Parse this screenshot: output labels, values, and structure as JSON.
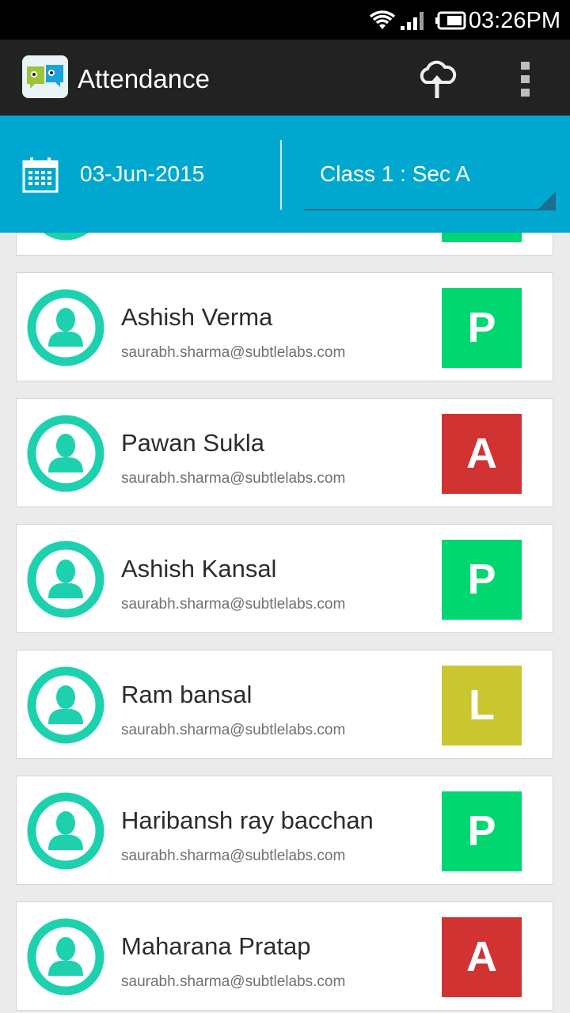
{
  "status_bar": {
    "time": "03:26PM"
  },
  "app_bar": {
    "title": "Attendance",
    "logo": "app-logo-icon",
    "upload_icon": "cloud-upload-icon",
    "menu_icon": "overflow-menu-icon"
  },
  "filter": {
    "date": "03-Jun-2015",
    "class_section": "Class 1 : Sec A",
    "calendar_icon": "calendar-icon"
  },
  "colors": {
    "present": "#00d770",
    "absent": "#d13333",
    "leave": "#c9c72f",
    "header": "#00a8cf",
    "appbar": "#222222",
    "avatar": "#1ed1ae"
  },
  "students": [
    {
      "name": "",
      "email": "",
      "status": "P"
    },
    {
      "name": "Ashish Verma",
      "email": "saurabh.sharma@subtlelabs.com",
      "status": "P"
    },
    {
      "name": "Pawan Sukla",
      "email": "saurabh.sharma@subtlelabs.com",
      "status": "A"
    },
    {
      "name": "Ashish Kansal",
      "email": "saurabh.sharma@subtlelabs.com",
      "status": "P"
    },
    {
      "name": "Ram bansal",
      "email": "saurabh.sharma@subtlelabs.com",
      "status": "L"
    },
    {
      "name": "Haribansh ray bacchan",
      "email": "saurabh.sharma@subtlelabs.com",
      "status": "P"
    },
    {
      "name": "Maharana Pratap",
      "email": "saurabh.sharma@subtlelabs.com",
      "status": "A"
    }
  ]
}
